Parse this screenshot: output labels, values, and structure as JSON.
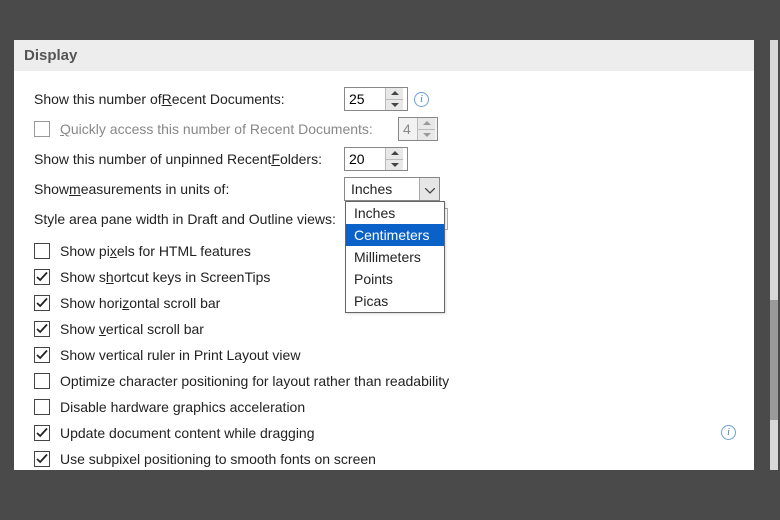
{
  "section_title": "Display",
  "labels": {
    "recent_docs_prefix": "Show this number of ",
    "recent_docs_u": "R",
    "recent_docs_suffix": "ecent Documents:",
    "quick_access_u": "Q",
    "quick_access_suffix": "uickly access this number of Recent Documents:",
    "recent_folders_prefix": "Show this number of unpinned Recent ",
    "recent_folders_u": "F",
    "recent_folders_suffix": "olders:",
    "measurements_prefix": "Show ",
    "measurements_u": "m",
    "measurements_suffix": "easurements in units of:",
    "style_area": "Style area pane width in Draft and Outline views:",
    "pixels_html_prefix": "Show pi",
    "pixels_html_u": "x",
    "pixels_html_suffix": "els for HTML features",
    "shortcut_prefix": "Show s",
    "shortcut_u": "h",
    "shortcut_suffix": "ortcut keys in ScreenTips",
    "hscroll_prefix": "Show hori",
    "hscroll_u": "z",
    "hscroll_suffix": "ontal scroll bar",
    "vscroll_prefix": "Show ",
    "vscroll_u": "v",
    "vscroll_suffix": "ertical scroll bar",
    "vruler": "Show vertical ruler in Print Layout view",
    "optimize": "Optimize character positioning for layout rather than readability",
    "disable_hw": "Disable hardware graphics acceleration",
    "update_drag": "Update document content while dragging",
    "subpixel": "Use subpixel positioning to smooth fonts on screen"
  },
  "values": {
    "recent_docs": "25",
    "quick_access": "4",
    "recent_folders": "20",
    "units_selected": "Inches"
  },
  "units_options": [
    "Inches",
    "Centimeters",
    "Millimeters",
    "Points",
    "Picas"
  ],
  "units_highlighted": "Centimeters",
  "checks": {
    "quick_access": false,
    "pixels_html": false,
    "shortcut": true,
    "hscroll": true,
    "vscroll": true,
    "vruler": true,
    "optimize": false,
    "disable_hw": false,
    "update_drag": true,
    "subpixel": true
  }
}
